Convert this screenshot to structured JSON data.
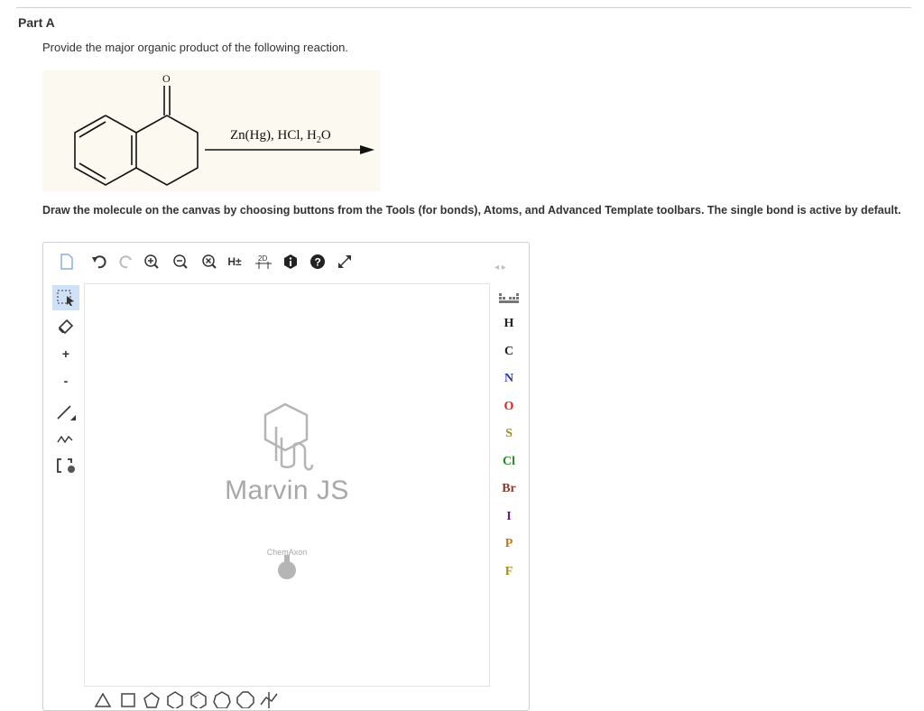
{
  "header": {
    "part_title": "Part A"
  },
  "question": {
    "prompt": "Provide the major organic product of the following reaction.",
    "reagent": {
      "pre": "Zn(Hg), HCl, H",
      "sub": "2",
      "post": "O"
    },
    "instructions": "Draw the molecule on the canvas by choosing buttons from the Tools (for bonds), Atoms, and Advanced Template toolbars. The single bond is active by default."
  },
  "editor": {
    "toolbar": {
      "h_toggle": "H±",
      "view_2d": "2D"
    },
    "left_tools": {
      "charge_plus": "+",
      "charge_minus": "-"
    },
    "atoms": [
      {
        "symbol": "H",
        "color": "#222222"
      },
      {
        "symbol": "C",
        "color": "#222222"
      },
      {
        "symbol": "N",
        "color": "#2b3aa8"
      },
      {
        "symbol": "O",
        "color": "#e0201b"
      },
      {
        "symbol": "S",
        "color": "#a88a1a"
      },
      {
        "symbol": "Cl",
        "color": "#1e8a1e"
      },
      {
        "symbol": "Br",
        "color": "#8a3a2a"
      },
      {
        "symbol": "I",
        "color": "#6a1a8a"
      },
      {
        "symbol": "P",
        "color": "#c07a10"
      },
      {
        "symbol": "F",
        "color": "#a88a1a"
      }
    ],
    "watermark": {
      "title": "Marvin JS",
      "subtitle": "ChemAxon"
    }
  }
}
